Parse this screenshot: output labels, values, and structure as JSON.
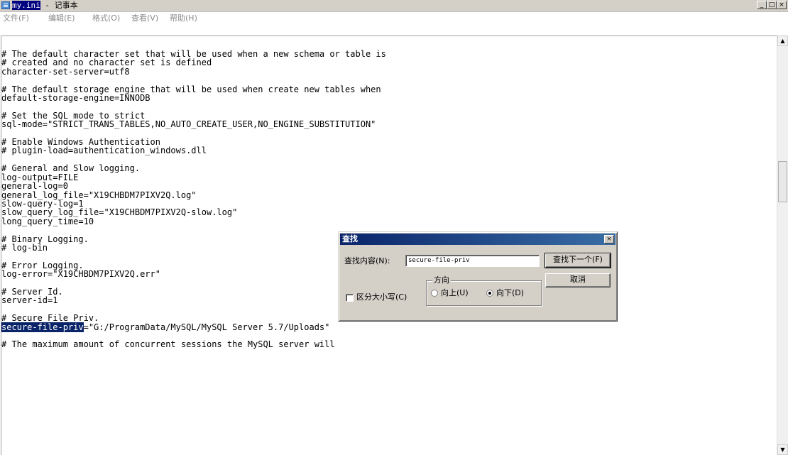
{
  "window": {
    "title_prefix": "my.ini",
    "title_suffix": " - 记事本",
    "minimize": "_",
    "maximize": "□",
    "close": "×",
    "app_icon": "notepad-icon"
  },
  "menu": [
    {
      "label": "文件(F)"
    },
    {
      "label": "编辑(E)"
    },
    {
      "label": "格式(O)"
    },
    {
      "label": "查看(V)"
    },
    {
      "label": "帮助(H)"
    }
  ],
  "editor": {
    "lines_before": "# The default character set that will be used when a new schema or table is\n# created and no character set is defined\ncharacter-set-server=utf8\n\n# The default storage engine that will be used when create new tables when\ndefault-storage-engine=INNODB\n\n# Set the SQL mode to strict\nsql-mode=\"STRICT_TRANS_TABLES,NO_AUTO_CREATE_USER,NO_ENGINE_SUBSTITUTION\"\n\n# Enable Windows Authentication\n# plugin-load=authentication_windows.dll\n\n# General and Slow logging.\nlog-output=FILE\ngeneral-log=0\ngeneral_log_file=\"X19CHBDM7PIXV2Q.log\"\nslow-query-log=1\nslow_query_log_file=\"X19CHBDM7PIXV2Q-slow.log\"\nlong_query_time=10\n\n# Binary Logging.\n# log-bin\n\n# Error Logging.\nlog-error=\"X19CHBDM7PIXV2Q.err\"\n\n# Server Id.\nserver-id=1\n\n# Secure File Priv.\n",
    "selected_text": "secure-file-priv",
    "selected_line_rest": "=\"G:/ProgramData/MySQL/MySQL Server 5.7/Uploads\"",
    "lines_after": "\n\n# The maximum amount of concurrent sessions the MySQL server will"
  },
  "scrollbar": {
    "up_arrow": "▲",
    "down_arrow": "▼"
  },
  "find_dialog": {
    "title": "查找",
    "close": "×",
    "find_label": "查找内容(N):",
    "find_value": "secure-file-priv",
    "find_next_button": "查找下一个(F)",
    "cancel_button": "取消",
    "direction_group": "方向",
    "up_label": "向上(U)",
    "down_label": "向下(D)",
    "direction_selected": "down",
    "match_case_label": "区分大小写(C)",
    "match_case_checked": false
  }
}
